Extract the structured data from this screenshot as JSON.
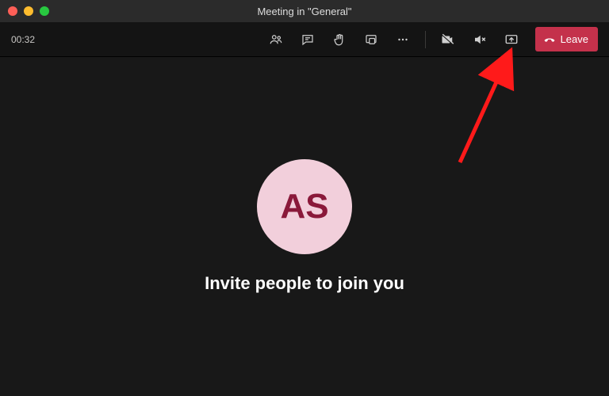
{
  "window": {
    "title": "Meeting in \"General\""
  },
  "toolbar": {
    "timer": "00:32",
    "leave_label": "Leave"
  },
  "participant": {
    "initials": "AS"
  },
  "stage": {
    "invite_text": "Invite people to join you"
  }
}
